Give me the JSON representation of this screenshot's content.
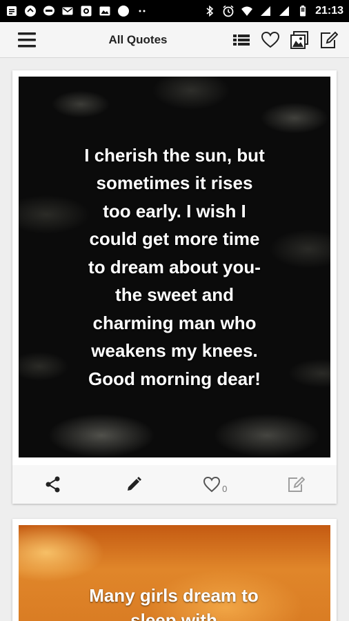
{
  "status_bar": {
    "time": "21:13",
    "left_icons": [
      "notification-list-icon",
      "chat-icon",
      "line-icon",
      "mail-icon",
      "photo-icon",
      "gallery-icon",
      "circle-icon",
      "more-dots-icon"
    ],
    "right_icons": [
      "bluetooth-icon",
      "alarm-icon",
      "wifi-icon",
      "signal-icon",
      "signal-icon",
      "battery-icon"
    ]
  },
  "app_bar": {
    "title": "All Quotes",
    "actions": [
      "list-icon",
      "heart-icon",
      "image-icon",
      "edit-icon"
    ]
  },
  "cards": [
    {
      "quote": "I cherish the sun, but\nsometimes it rises\ntoo early. I wish I\ncould get more time\nto dream about you-\nthe sweet and\ncharming man who\nweakens my knees.\nGood morning dear!",
      "like_count": "0",
      "actions": [
        "share-icon",
        "pencil-icon",
        "heart-icon",
        "edit-icon"
      ]
    },
    {
      "quote": "Many girls dream to\nsleep with"
    }
  ],
  "colors": {
    "status_bar_bg": "#000000",
    "app_bar_bg": "#f5f5f5",
    "page_bg": "#eeeeee",
    "icon_dark": "#222222",
    "icon_muted": "#9e9e9e"
  }
}
